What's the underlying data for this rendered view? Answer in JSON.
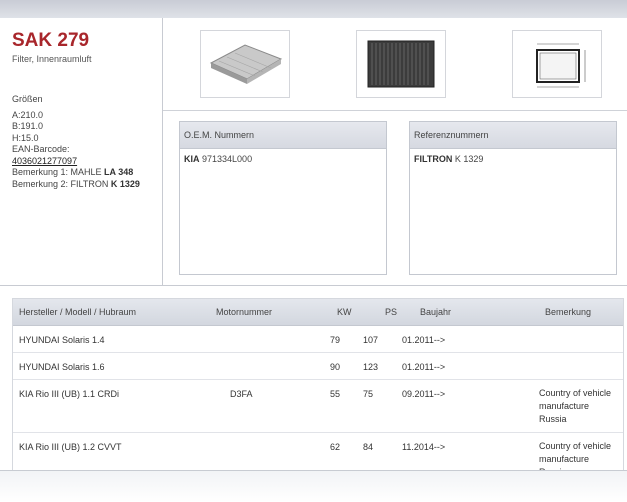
{
  "product": {
    "code": "SAK 279",
    "subtitle": "Filter, Innenraumluft",
    "sizes_heading": "Größen",
    "a": "A:210.0",
    "b": "B:191.0",
    "h": "H:15.0",
    "ean_label": "EAN-Barcode:",
    "ean_value": "4036021277097",
    "note1_prefix": "Bemerkung 1: MAHLE ",
    "note1_bold": "LA 348",
    "note2_prefix": "Bemerkung 2: FILTRON ",
    "note2_bold": "K 1329"
  },
  "images": [
    {
      "name": "filter-side-view-image"
    },
    {
      "name": "filter-top-view-image"
    },
    {
      "name": "filter-dimension-drawing"
    }
  ],
  "oem": {
    "heading": "O.E.M. Nummern",
    "brand": "KIA",
    "number": "971334L000"
  },
  "references": {
    "heading": "Referenznummern",
    "brand": "FILTRON",
    "number": "K 1329"
  },
  "applications": {
    "headers": {
      "vehicle": "Hersteller / Modell / Hubraum",
      "engine": "Motornummer",
      "kw": "KW",
      "ps": "PS",
      "year": "Baujahr",
      "remark": "Bemerkung"
    },
    "rows": [
      {
        "vehicle": "HYUNDAI Solaris 1.4",
        "engine": "",
        "kw": "79",
        "ps": "107",
        "year": "01.2011-->",
        "remark": ""
      },
      {
        "vehicle": "HYUNDAI Solaris 1.6",
        "engine": "",
        "kw": "90",
        "ps": "123",
        "year": "01.2011-->",
        "remark": ""
      },
      {
        "vehicle": "KIA Rio III (UB) 1.1 CRDi",
        "engine": "D3FA",
        "kw": "55",
        "ps": "75",
        "year": "09.2011-->",
        "remark": "Country of vehicle manufacture Russia"
      },
      {
        "vehicle": "KIA Rio III (UB) 1.2 CVVT",
        "engine": "",
        "kw": "62",
        "ps": "84",
        "year": "11.2014-->",
        "remark": "Country of vehicle manufacture Russia"
      }
    ]
  }
}
